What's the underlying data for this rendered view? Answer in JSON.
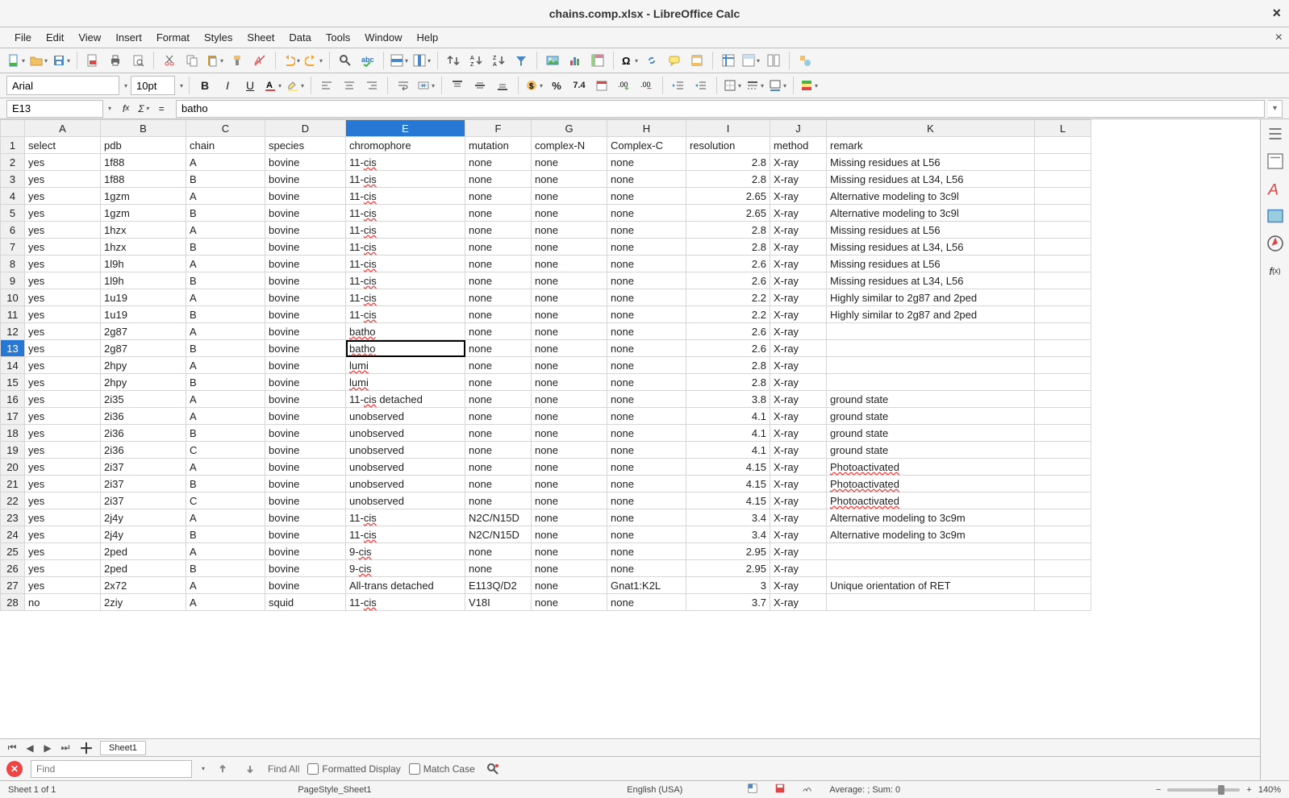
{
  "title": "chains.comp.xlsx - LibreOffice Calc",
  "menu": [
    "File",
    "Edit",
    "View",
    "Insert",
    "Format",
    "Styles",
    "Sheet",
    "Data",
    "Tools",
    "Window",
    "Help"
  ],
  "font": {
    "name": "Arial",
    "size": "10pt"
  },
  "nameBox": "E13",
  "formula": "batho",
  "activeCol": "E",
  "activeRow": 13,
  "columns": [
    "A",
    "B",
    "C",
    "D",
    "E",
    "F",
    "G",
    "H",
    "I",
    "J",
    "K",
    "L"
  ],
  "headers": [
    "select",
    "pdb",
    "chain",
    "species",
    "chromophore",
    "mutation",
    "complex-N",
    "Complex-C",
    "resolution",
    "method",
    "remark"
  ],
  "rows": [
    [
      "yes",
      "1f88",
      "A",
      "bovine",
      "11-cis",
      "none",
      "none",
      "none",
      "2.8",
      "X-ray",
      "Missing residues at L56"
    ],
    [
      "yes",
      "1f88",
      "B",
      "bovine",
      "11-cis",
      "none",
      "none",
      "none",
      "2.8",
      "X-ray",
      "Missing residues at L34, L56"
    ],
    [
      "yes",
      "1gzm",
      "A",
      "bovine",
      "11-cis",
      "none",
      "none",
      "none",
      "2.65",
      "X-ray",
      "Alternative modeling to 3c9l"
    ],
    [
      "yes",
      "1gzm",
      "B",
      "bovine",
      "11-cis",
      "none",
      "none",
      "none",
      "2.65",
      "X-ray",
      "Alternative modeling to 3c9l"
    ],
    [
      "yes",
      "1hzx",
      "A",
      "bovine",
      "11-cis",
      "none",
      "none",
      "none",
      "2.8",
      "X-ray",
      "Missing residues at L56"
    ],
    [
      "yes",
      "1hzx",
      "B",
      "bovine",
      "11-cis",
      "none",
      "none",
      "none",
      "2.8",
      "X-ray",
      "Missing residues at L34, L56"
    ],
    [
      "yes",
      "1l9h",
      "A",
      "bovine",
      "11-cis",
      "none",
      "none",
      "none",
      "2.6",
      "X-ray",
      "Missing residues at L56"
    ],
    [
      "yes",
      "1l9h",
      "B",
      "bovine",
      "11-cis",
      "none",
      "none",
      "none",
      "2.6",
      "X-ray",
      "Missing residues at L34, L56"
    ],
    [
      "yes",
      "1u19",
      "A",
      "bovine",
      "11-cis",
      "none",
      "none",
      "none",
      "2.2",
      "X-ray",
      "Highly similar to 2g87 and 2ped"
    ],
    [
      "yes",
      "1u19",
      "B",
      "bovine",
      "11-cis",
      "none",
      "none",
      "none",
      "2.2",
      "X-ray",
      "Highly similar to 2g87 and 2ped"
    ],
    [
      "yes",
      "2g87",
      "A",
      "bovine",
      "batho",
      "none",
      "none",
      "none",
      "2.6",
      "X-ray",
      ""
    ],
    [
      "yes",
      "2g87",
      "B",
      "bovine",
      "batho",
      "none",
      "none",
      "none",
      "2.6",
      "X-ray",
      ""
    ],
    [
      "yes",
      "2hpy",
      "A",
      "bovine",
      "lumi",
      "none",
      "none",
      "none",
      "2.8",
      "X-ray",
      ""
    ],
    [
      "yes",
      "2hpy",
      "B",
      "bovine",
      "lumi",
      "none",
      "none",
      "none",
      "2.8",
      "X-ray",
      ""
    ],
    [
      "yes",
      "2i35",
      "A",
      "bovine",
      "11-cis detached",
      "none",
      "none",
      "none",
      "3.8",
      "X-ray",
      "ground state"
    ],
    [
      "yes",
      "2i36",
      "A",
      "bovine",
      "unobserved",
      "none",
      "none",
      "none",
      "4.1",
      "X-ray",
      "ground state"
    ],
    [
      "yes",
      "2i36",
      "B",
      "bovine",
      "unobserved",
      "none",
      "none",
      "none",
      "4.1",
      "X-ray",
      "ground state"
    ],
    [
      "yes",
      "2i36",
      "C",
      "bovine",
      "unobserved",
      "none",
      "none",
      "none",
      "4.1",
      "X-ray",
      "ground state"
    ],
    [
      "yes",
      "2i37",
      "A",
      "bovine",
      "unobserved",
      "none",
      "none",
      "none",
      "4.15",
      "X-ray",
      "Photoactivated"
    ],
    [
      "yes",
      "2i37",
      "B",
      "bovine",
      "unobserved",
      "none",
      "none",
      "none",
      "4.15",
      "X-ray",
      "Photoactivated"
    ],
    [
      "yes",
      "2i37",
      "C",
      "bovine",
      "unobserved",
      "none",
      "none",
      "none",
      "4.15",
      "X-ray",
      "Photoactivated"
    ],
    [
      "yes",
      "2j4y",
      "A",
      "bovine",
      "11-cis",
      "N2C/N15D",
      "none",
      "none",
      "3.4",
      "X-ray",
      "Alternative modeling to 3c9m"
    ],
    [
      "yes",
      "2j4y",
      "B",
      "bovine",
      "11-cis",
      "N2C/N15D",
      "none",
      "none",
      "3.4",
      "X-ray",
      "Alternative modeling to 3c9m"
    ],
    [
      "yes",
      "2ped",
      "A",
      "bovine",
      "9-cis",
      "none",
      "none",
      "none",
      "2.95",
      "X-ray",
      ""
    ],
    [
      "yes",
      "2ped",
      "B",
      "bovine",
      "9-cis",
      "none",
      "none",
      "none",
      "2.95",
      "X-ray",
      ""
    ],
    [
      "yes",
      "2x72",
      "A",
      "bovine",
      "All-trans detached",
      "E113Q/D2",
      "none",
      "Gnat1:K2L",
      "3",
      "X-ray",
      "Unique orientation of RET"
    ],
    [
      "no",
      "2ziy",
      "A",
      "squid",
      "11-cis",
      "V18I",
      "none",
      "none",
      "3.7",
      "X-ray",
      ""
    ]
  ],
  "sheetTab": "Sheet1",
  "find": {
    "placeholder": "Find",
    "findAll": "Find All",
    "formatted": "Formatted Display",
    "matchCase": "Match Case"
  },
  "status": {
    "sheetCount": "Sheet 1 of 1",
    "pageStyle": "PageStyle_Sheet1",
    "lang": "English (USA)",
    "avg": "Average: ; Sum: 0",
    "zoom": "140%"
  },
  "icons": {
    "new": "new-icon",
    "open": "open-icon",
    "save": "save-icon",
    "pdf": "export-pdf-icon",
    "print": "print-icon",
    "preview": "print-preview-icon",
    "cut": "cut-icon",
    "copy": "copy-icon",
    "paste": "paste-icon",
    "clone": "clone-format-icon",
    "clear": "clear-format-icon",
    "undo": "undo-icon",
    "redo": "redo-icon",
    "find": "find-replace-icon",
    "spell": "spellcheck-icon",
    "row": "row-icon",
    "col": "column-icon",
    "sortA": "sort-asc-icon",
    "sortD": "sort-desc-icon",
    "filter": "autofilter-icon",
    "img": "image-icon",
    "chart": "chart-icon",
    "pivot": "pivot-icon",
    "spec": "special-char-icon",
    "link": "hyperlink-icon",
    "comment": "comment-icon",
    "header": "headers-icon",
    "freeze": "freeze-icon",
    "split": "split-icon",
    "draw": "draw-icon",
    "bold": "bold-icon",
    "italic": "italic-icon",
    "underline": "underline-icon",
    "fontcolor": "font-color-icon",
    "bgcolor": "highlight-icon",
    "alignL": "align-left-icon",
    "alignC": "align-center-icon",
    "alignR": "align-right-icon",
    "alignT": "align-top-icon",
    "alignM": "align-middle-icon",
    "alignB": "align-bottom-icon",
    "merge": "merge-icon",
    "wrap": "wrap-icon",
    "currency": "currency-icon",
    "percent": "percent-icon",
    "number": "number-icon",
    "date": "date-icon",
    "decAdd": "decimal-add-icon",
    "decDel": "decimal-del-icon",
    "indentInc": "indent-inc-icon",
    "indentDec": "indent-dec-icon",
    "borders": "borders-icon",
    "borderStyle": "border-style-icon",
    "borderColor": "border-color-icon",
    "cond": "conditional-icon"
  }
}
